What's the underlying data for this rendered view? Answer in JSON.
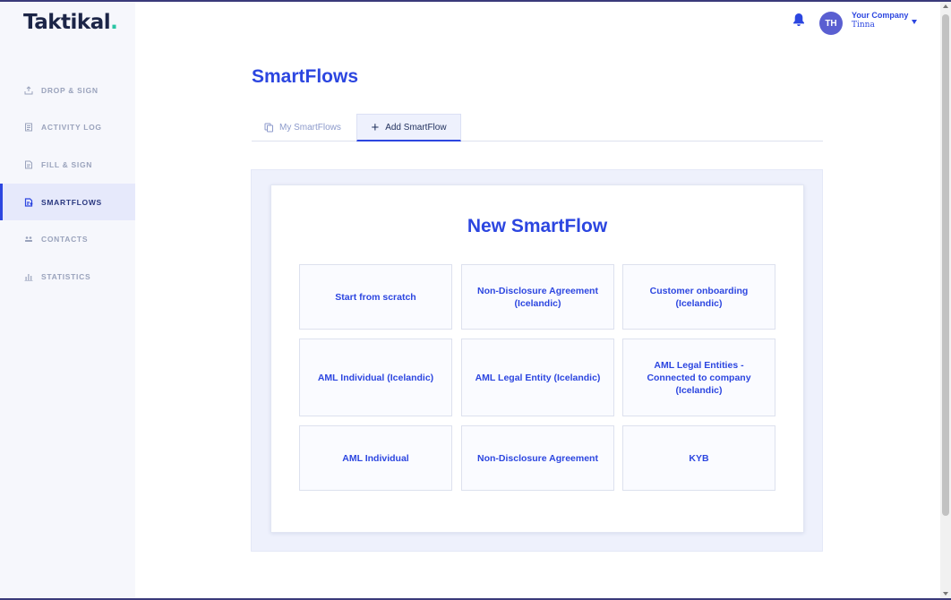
{
  "logo": {
    "text": "Taktikal",
    "dot": "."
  },
  "sidebar": {
    "items": [
      {
        "label": "DROP & SIGN",
        "icon": "upload-icon",
        "active": false
      },
      {
        "label": "ACTIVITY LOG",
        "icon": "document-icon",
        "active": false
      },
      {
        "label": "FILL & SIGN",
        "icon": "form-icon",
        "active": false
      },
      {
        "label": "SMARTFLOWS",
        "icon": "flow-icon",
        "active": true
      },
      {
        "label": "CONTACTS",
        "icon": "people-icon",
        "active": false
      },
      {
        "label": "STATISTICS",
        "icon": "bar-chart-icon",
        "active": false
      }
    ]
  },
  "header": {
    "avatar_initials": "TH",
    "company": "Your Company",
    "user": "Tinna"
  },
  "main": {
    "title": "SmartFlows",
    "tabs": [
      {
        "label": "My SmartFlows",
        "icon": "copy-icon"
      },
      {
        "label": "Add SmartFlow",
        "icon": "plus-icon",
        "selected": true
      }
    ],
    "panel_title": "New SmartFlow",
    "templates": [
      "Start from scratch",
      "Non-Disclosure Agreement (Icelandic)",
      "Customer onboarding (Icelandic)",
      "AML Individual (Icelandic)",
      "AML Legal Entity (Icelandic)",
      "AML Legal Entities - Connected to company (Icelandic)",
      "AML Individual",
      "Non-Disclosure Agreement",
      "KYB"
    ]
  },
  "colors": {
    "accent": "#2c46e0",
    "logo_dot": "#2bc5a4",
    "avatar": "#5a5fd1",
    "sidebar_bg": "#f6f7fc"
  }
}
